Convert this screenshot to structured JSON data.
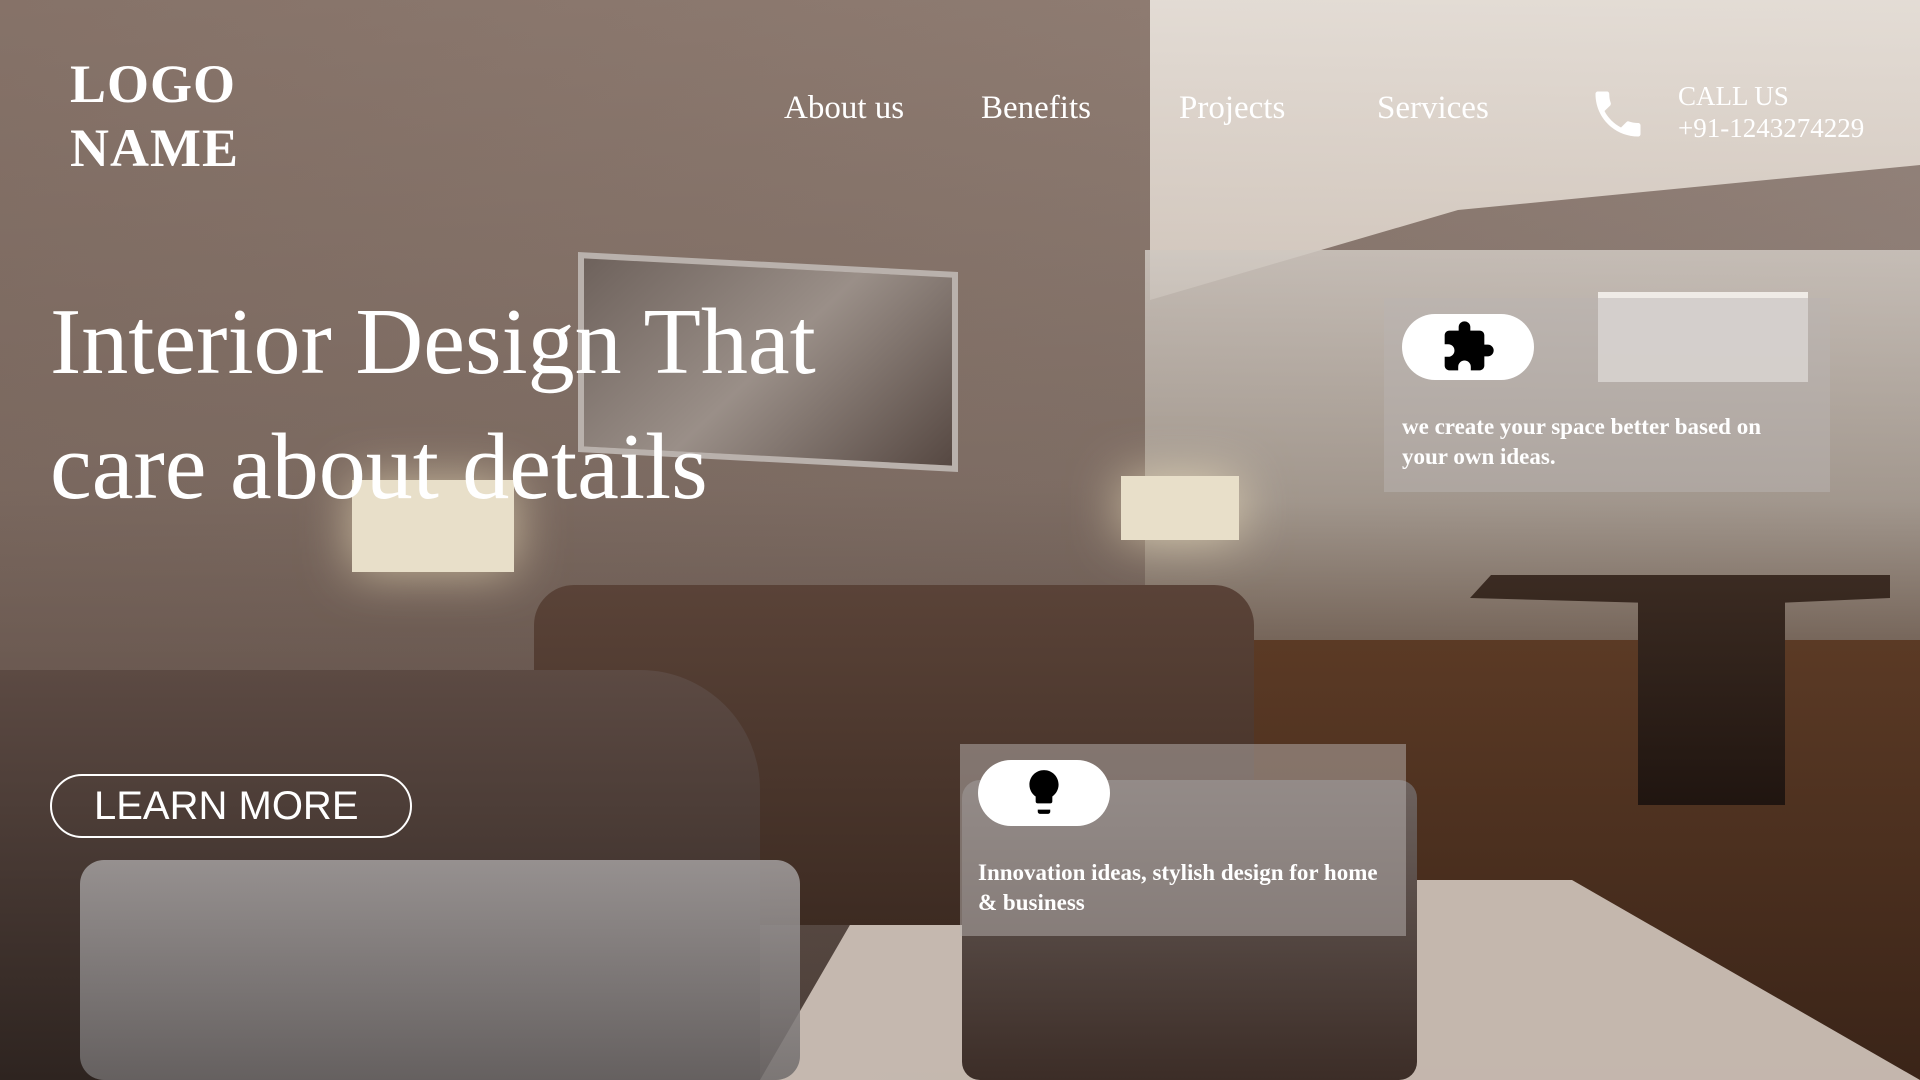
{
  "logo": {
    "line1": "LOGO",
    "line2": "NAME"
  },
  "nav": {
    "items": [
      "About us",
      "Benefits",
      "Projects",
      "Services"
    ]
  },
  "call": {
    "label": "CALL US",
    "phone": "+91-1243274229"
  },
  "hero": {
    "headline_line1": "Interior Design That",
    "headline_line2": "care about details",
    "cta_label": "LEARN MORE"
  },
  "cards": [
    {
      "icon": "puzzle-icon",
      "text": "we create your space better based on your own ideas."
    },
    {
      "icon": "lightbulb-icon",
      "text": "Innovation ideas, stylish design for home & business"
    }
  ],
  "colors": {
    "text": "#ffffff",
    "card_bg": "#b9b4b2",
    "pill_bg": "#ffffff"
  }
}
